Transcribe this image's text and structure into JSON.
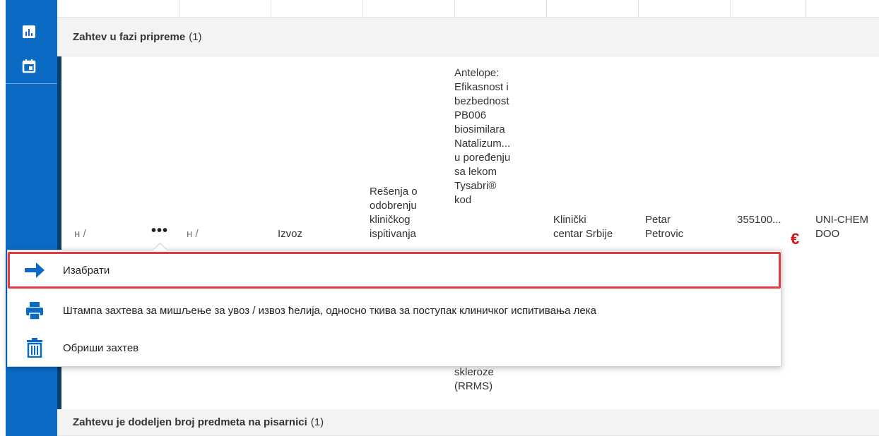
{
  "groups": [
    {
      "label": "Zahtev u fazi pripreme",
      "count": "(1)"
    },
    {
      "label": "Zahtevu je dodeljen broj predmeta na pisarnici",
      "count": "(1)"
    }
  ],
  "row": {
    "col1": "н /",
    "col2": "н /",
    "type": "Izvoz",
    "decision": [
      "Rešenja o",
      "odobrenju",
      "kliničkog",
      "ispitivanja"
    ],
    "title": [
      "Antelope:",
      "Efikasnost i",
      "bezbednost",
      "PB006",
      "biosimilara",
      "Natalizum...",
      "u poređenju",
      "sa lekom",
      "Tysabri®",
      "kod"
    ],
    "title_tail": [
      "skleroze",
      "(RRMS)"
    ],
    "institution": [
      "Klinički",
      "centar Srbije"
    ],
    "person": [
      "Petar",
      "Petrovic"
    ],
    "amount": "355100...",
    "currency": "€",
    "company": [
      "UNI-CHEM",
      "DOO"
    ]
  },
  "menu": {
    "items": [
      {
        "label": "Изабрати",
        "icon": "arrow-right-icon"
      },
      {
        "label": "Штампа захтева за мишљење за увоз / извоз ћелија, односно ткива за поступак клиничког испитивања лека",
        "icon": "printer-icon"
      },
      {
        "label": "Обриши захтев",
        "icon": "trash-icon"
      }
    ]
  },
  "colors": {
    "sidebar": "#0b6ac4",
    "accent": "#0c3e6e",
    "highlight": "#e03a45",
    "euro": "#d4121d"
  },
  "sidebar_icons": [
    "bar-chart-icon",
    "calendar-icon"
  ]
}
